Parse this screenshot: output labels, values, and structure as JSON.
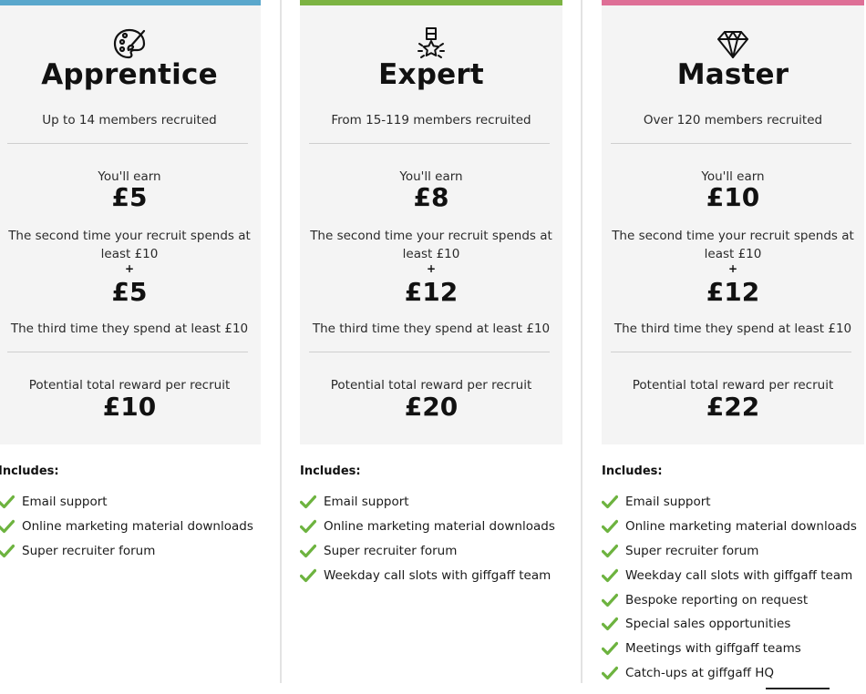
{
  "tiers": [
    {
      "title": "Apprentice",
      "icon": "palette-icon",
      "accent_color": "#5aa7cc",
      "subtitle": "Up to 14 members recruited",
      "earn_label": "You'll earn",
      "first_amount": "£5",
      "first_condition": "The second time your recruit spends at least £10",
      "plus": "+",
      "second_amount": "£5",
      "second_condition": "The third time they spend at least £10",
      "potential_label": "Potential total reward per recruit",
      "total": "£10",
      "includes_label": "Includes:",
      "features": [
        "Email support",
        "Online marketing material downloads",
        "Super recruiter forum"
      ]
    },
    {
      "title": "Expert",
      "icon": "medal-icon",
      "accent_color": "#7cb342",
      "subtitle": "From 15-119 members recruited",
      "earn_label": "You'll earn",
      "first_amount": "£8",
      "first_condition": "The second time your recruit spends at least £10",
      "plus": "+",
      "second_amount": "£12",
      "second_condition": "The third time they spend at least £10",
      "potential_label": "Potential total reward per recruit",
      "total": "£20",
      "includes_label": "Includes:",
      "features": [
        "Email support",
        "Online marketing material downloads",
        "Super recruiter forum",
        "Weekday call slots with giffgaff team"
      ]
    },
    {
      "title": "Master",
      "icon": "diamond-icon",
      "accent_color": "#de6f96",
      "subtitle": "Over 120 members recruited",
      "earn_label": "You'll earn",
      "first_amount": "£10",
      "first_condition": "The second time your recruit spends at least £10",
      "plus": "+",
      "second_amount": "£12",
      "second_condition": "The third time they spend at least £10",
      "potential_label": "Potential total reward per recruit",
      "total": "£22",
      "includes_label": "Includes:",
      "features": [
        "Email support",
        "Online marketing material downloads",
        "Super recruiter forum",
        "Weekday call slots with giffgaff team",
        "Bespoke reporting on request",
        "Special sales opportunities",
        "Meetings with giffgaff teams",
        "Catch-ups at giffgaff HQ"
      ]
    }
  ],
  "check_color": "#6db33f"
}
